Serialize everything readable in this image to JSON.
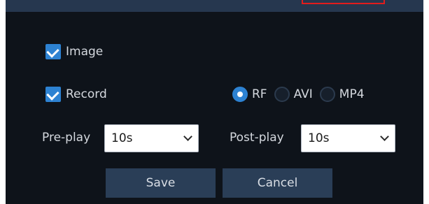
{
  "checkboxes": {
    "image": {
      "label": "Image",
      "checked": true
    },
    "record": {
      "label": "Record",
      "checked": true
    }
  },
  "format": {
    "options": [
      "RF",
      "AVI",
      "MP4"
    ],
    "selected": "RF"
  },
  "pre_play": {
    "label": "Pre-play",
    "value": "10s"
  },
  "post_play": {
    "label": "Post-play",
    "value": "10s"
  },
  "buttons": {
    "save": "Save",
    "cancel": "Cancel"
  },
  "colors": {
    "panel_bg": "#0e131a",
    "accent": "#2d82d2",
    "button_bg": "#2a3e57",
    "highlight_outline": "#e21c1c"
  }
}
